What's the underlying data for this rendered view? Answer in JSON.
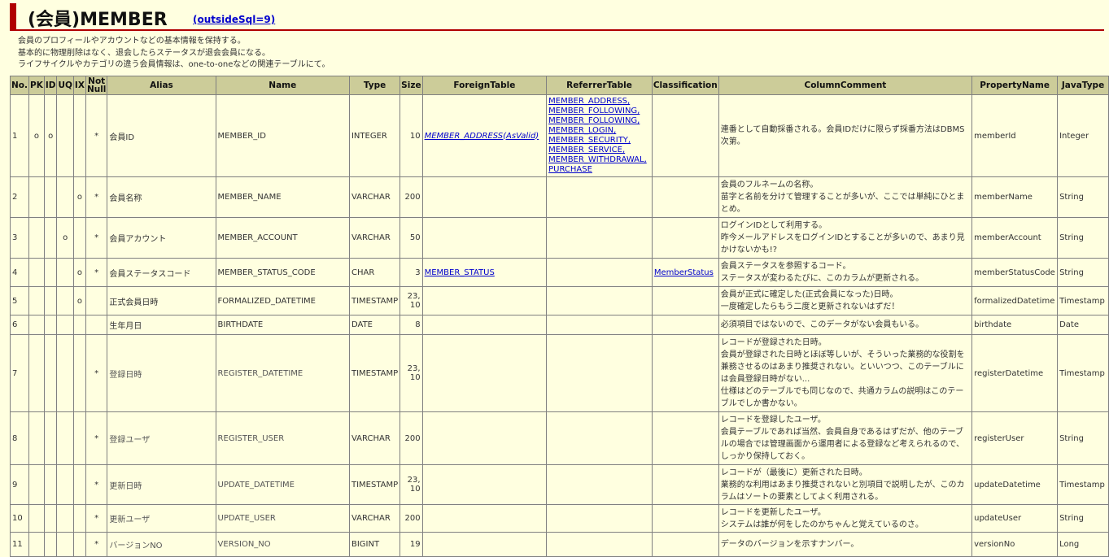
{
  "title": {
    "text": "(会員)MEMBER",
    "link": "(outsideSql=9)"
  },
  "description": [
    "会員のプロフィールやアカウントなどの基本情報を保持する。",
    "基本的に物理削除はなく、退会したらステータスが退会会員になる。",
    "ライフサイクルやカテゴリの違う会員情報は、one-to-oneなどの関連テーブルにて。"
  ],
  "headers": {
    "no": "No.",
    "pk": "PK",
    "id": "ID",
    "uq": "UQ",
    "ix": "IX",
    "not_null": "Not Null",
    "alias": "Alias",
    "name": "Name",
    "type": "Type",
    "size": "Size",
    "foreign": "ForeignTable",
    "referrer": "ReferrerTable",
    "classification": "Classification",
    "comment": "ColumnComment",
    "property": "PropertyName",
    "java": "JavaType"
  },
  "rows": [
    {
      "no": "1",
      "pk": "o",
      "id": "o",
      "uq": "",
      "ix": "",
      "nn": "*",
      "alias": "会員ID",
      "name": "MEMBER_ID",
      "type": "INTEGER",
      "size": "10",
      "foreign": "MEMBER_ADDRESS(AsValid)",
      "referrer": [
        "MEMBER_ADDRESS,",
        "MEMBER_FOLLOWING,",
        "MEMBER_FOLLOWING,",
        "MEMBER_LOGIN,",
        "MEMBER_SECURITY,",
        "MEMBER_SERVICE,",
        "MEMBER_WITHDRAWAL,",
        "PURCHASE"
      ],
      "classification": "",
      "comment": "連番として自動採番される。会員IDだけに限らず採番方法はDBMS次第。",
      "property": "memberId",
      "java": "Integer"
    },
    {
      "no": "2",
      "pk": "",
      "id": "",
      "uq": "",
      "ix": "o",
      "nn": "*",
      "alias": "会員名称",
      "name": "MEMBER_NAME",
      "type": "VARCHAR",
      "size": "200",
      "foreign": "",
      "referrer": [],
      "classification": "",
      "comment": "会員のフルネームの名称。\n苗字と名前を分けて管理することが多いが、ここでは単純にひとまとめ。",
      "property": "memberName",
      "java": "String"
    },
    {
      "no": "3",
      "pk": "",
      "id": "",
      "uq": "o",
      "ix": "",
      "nn": "*",
      "alias": "会員アカウント",
      "name": "MEMBER_ACCOUNT",
      "type": "VARCHAR",
      "size": "50",
      "foreign": "",
      "referrer": [],
      "classification": "",
      "comment": "ログインIDとして利用する。\n昨今メールアドレスをログインIDとすることが多いので、あまり見かけないかも!?",
      "property": "memberAccount",
      "java": "String"
    },
    {
      "no": "4",
      "pk": "",
      "id": "",
      "uq": "",
      "ix": "o",
      "nn": "*",
      "alias": "会員ステータスコード",
      "name": "MEMBER_STATUS_CODE",
      "type": "CHAR",
      "size": "3",
      "foreign": "MEMBER_STATUS",
      "referrer": [],
      "classification": "MemberStatus",
      "comment": "会員ステータスを参照するコード。\nステータスが変わるたびに、このカラムが更新される。",
      "property": "memberStatusCode",
      "java": "String"
    },
    {
      "no": "5",
      "pk": "",
      "id": "",
      "uq": "",
      "ix": "o",
      "nn": "",
      "alias": "正式会員日時",
      "name": "FORMALIZED_DATETIME",
      "type": "TIMESTAMP",
      "size": "23,\n10",
      "foreign": "",
      "referrer": [],
      "classification": "",
      "comment": "会員が正式に確定した(正式会員になった)日時。\n一度確定したらもう二度と更新されないはずだ！",
      "property": "formalizedDatetime",
      "java": "Timestamp"
    },
    {
      "no": "6",
      "pk": "",
      "id": "",
      "uq": "",
      "ix": "",
      "nn": "",
      "alias": "生年月日",
      "name": "BIRTHDATE",
      "type": "DATE",
      "size": "8",
      "foreign": "",
      "referrer": [],
      "classification": "",
      "comment": "必須項目ではないので、このデータがない会員もいる。",
      "property": "birthdate",
      "java": "Date"
    },
    {
      "no": "7",
      "pk": "",
      "id": "",
      "uq": "",
      "ix": "",
      "nn": "*",
      "alias": "登録日時",
      "name": "REGISTER_DATETIME",
      "type": "TIMESTAMP",
      "size": "23,\n10",
      "foreign": "",
      "referrer": [],
      "classification": "",
      "comment": "レコードが登録された日時。\n会員が登録された日時とほぼ等しいが、そういった業務的な役割を兼務させるのはあまり推奨されない。といいつつ、このテーブルには会員登録日時がない...\n仕様はどのテーブルでも同じなので、共通カラムの説明はこのテーブルでしか書かない。",
      "property": "registerDatetime",
      "java": "Timestamp"
    },
    {
      "no": "8",
      "pk": "",
      "id": "",
      "uq": "",
      "ix": "",
      "nn": "*",
      "alias": "登録ユーザ",
      "name": "REGISTER_USER",
      "type": "VARCHAR",
      "size": "200",
      "foreign": "",
      "referrer": [],
      "classification": "",
      "comment": "レコードを登録したユーザ。\n会員テーブルであれば当然、会員自身であるはずだが、他のテーブルの場合では管理画面から運用者による登録など考えられるので、しっかり保持しておく。",
      "property": "registerUser",
      "java": "String"
    },
    {
      "no": "9",
      "pk": "",
      "id": "",
      "uq": "",
      "ix": "",
      "nn": "*",
      "alias": "更新日時",
      "name": "UPDATE_DATETIME",
      "type": "TIMESTAMP",
      "size": "23,\n10",
      "foreign": "",
      "referrer": [],
      "classification": "",
      "comment": "レコードが（最後に）更新された日時。\n業務的な利用はあまり推奨されないと別項目で説明したが、このカラムはソートの要素としてよく利用される。",
      "property": "updateDatetime",
      "java": "Timestamp"
    },
    {
      "no": "10",
      "pk": "",
      "id": "",
      "uq": "",
      "ix": "",
      "nn": "*",
      "alias": "更新ユーザ",
      "name": "UPDATE_USER",
      "type": "VARCHAR",
      "size": "200",
      "foreign": "",
      "referrer": [],
      "classification": "",
      "comment": "レコードを更新したユーザ。\nシステムは誰が何をしたのかちゃんと覚えているのさ。",
      "property": "updateUser",
      "java": "String"
    },
    {
      "no": "11",
      "pk": "",
      "id": "",
      "uq": "",
      "ix": "",
      "nn": "*",
      "alias": "バージョンNO",
      "name": "VERSION_NO",
      "type": "BIGINT",
      "size": "19",
      "foreign": "",
      "referrer": [],
      "classification": "",
      "comment": "データのバージョンを示すナンバー。",
      "property": "versionNo",
      "java": "Long"
    }
  ]
}
